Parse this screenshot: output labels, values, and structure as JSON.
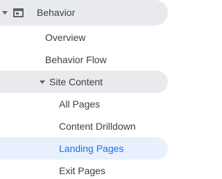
{
  "nav": {
    "behavior": {
      "label": "Behavior",
      "expanded": true,
      "icon": "behavior-window-icon"
    },
    "items": [
      {
        "label": "Overview"
      },
      {
        "label": "Behavior Flow"
      }
    ],
    "site_content": {
      "label": "Site Content",
      "expanded": true,
      "children": [
        {
          "label": "All Pages"
        },
        {
          "label": "Content Drilldown"
        },
        {
          "label": "Landing Pages",
          "active": true
        },
        {
          "label": "Exit Pages"
        }
      ]
    }
  },
  "colors": {
    "active_text": "#1a73e8",
    "active_bg": "#e8f0fe",
    "section_bg": "#e8eaed",
    "text": "#3c4043",
    "icon": "#5f6368"
  }
}
